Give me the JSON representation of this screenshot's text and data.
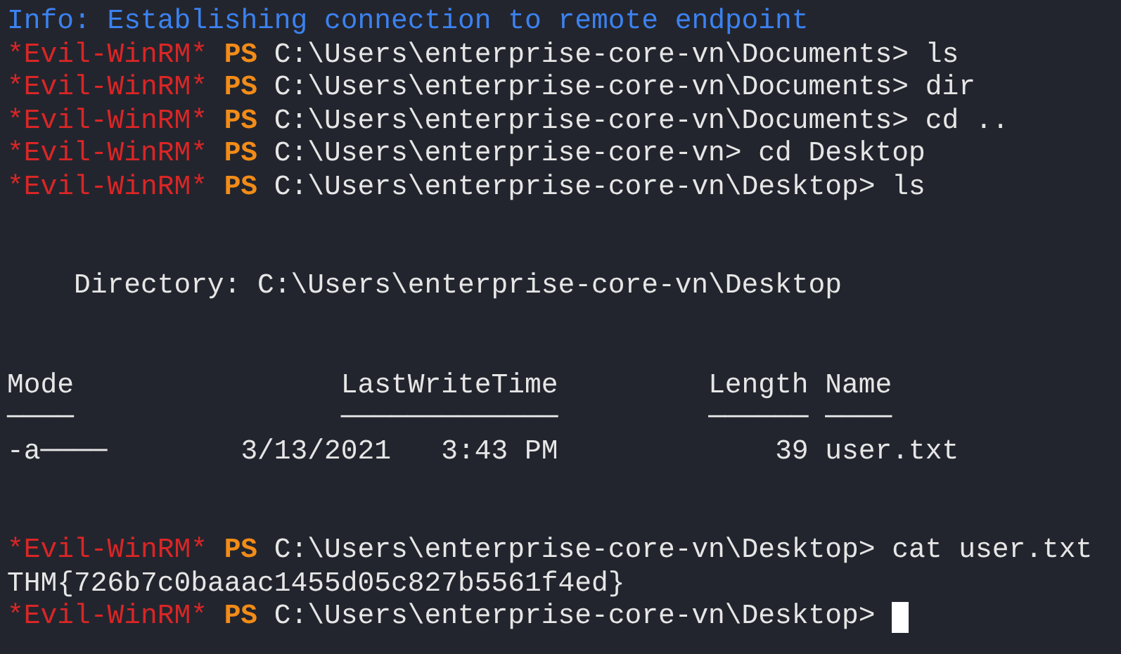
{
  "lines": [
    {
      "kind": "info",
      "text": "Info: Establishing connection to remote endpoint"
    },
    {
      "kind": "prompt",
      "tag": "*Evil-WinRM*",
      "shell": "PS",
      "path": "C:\\Users\\enterprise-core-vn\\Documents>",
      "command": "ls"
    },
    {
      "kind": "prompt",
      "tag": "*Evil-WinRM*",
      "shell": "PS",
      "path": "C:\\Users\\enterprise-core-vn\\Documents>",
      "command": "dir"
    },
    {
      "kind": "prompt",
      "tag": "*Evil-WinRM*",
      "shell": "PS",
      "path": "C:\\Users\\enterprise-core-vn\\Documents>",
      "command": "cd .."
    },
    {
      "kind": "prompt",
      "tag": "*Evil-WinRM*",
      "shell": "PS",
      "path": "C:\\Users\\enterprise-core-vn>",
      "command": "cd Desktop"
    },
    {
      "kind": "prompt",
      "tag": "*Evil-WinRM*",
      "shell": "PS",
      "path": "C:\\Users\\enterprise-core-vn\\Desktop>",
      "command": "ls"
    },
    {
      "kind": "blank"
    },
    {
      "kind": "blank"
    },
    {
      "kind": "directory",
      "text": "Directory: C:\\Users\\enterprise-core-vn\\Desktop"
    },
    {
      "kind": "blank"
    },
    {
      "kind": "blank"
    },
    {
      "kind": "table-header",
      "cells": [
        "Mode",
        "LastWriteTime",
        "Length",
        "Name"
      ]
    },
    {
      "kind": "table-rule",
      "cells": [
        "────",
        "─────────────",
        "──────",
        "────"
      ]
    },
    {
      "kind": "table-row",
      "cells": [
        "-a────",
        "3/13/2021",
        "3:43 PM",
        "39",
        "user.txt"
      ]
    },
    {
      "kind": "blank"
    },
    {
      "kind": "blank"
    },
    {
      "kind": "prompt",
      "tag": "*Evil-WinRM*",
      "shell": "PS",
      "path": "C:\\Users\\enterprise-core-vn\\Desktop>",
      "command": "cat user.txt"
    },
    {
      "kind": "output",
      "text": "THM{726b7c0baaac1455d05c827b5561f4ed}"
    },
    {
      "kind": "prompt",
      "tag": "*Evil-WinRM*",
      "shell": "PS",
      "path": "C:\\Users\\enterprise-core-vn\\Desktop>",
      "cursor": true
    }
  ]
}
